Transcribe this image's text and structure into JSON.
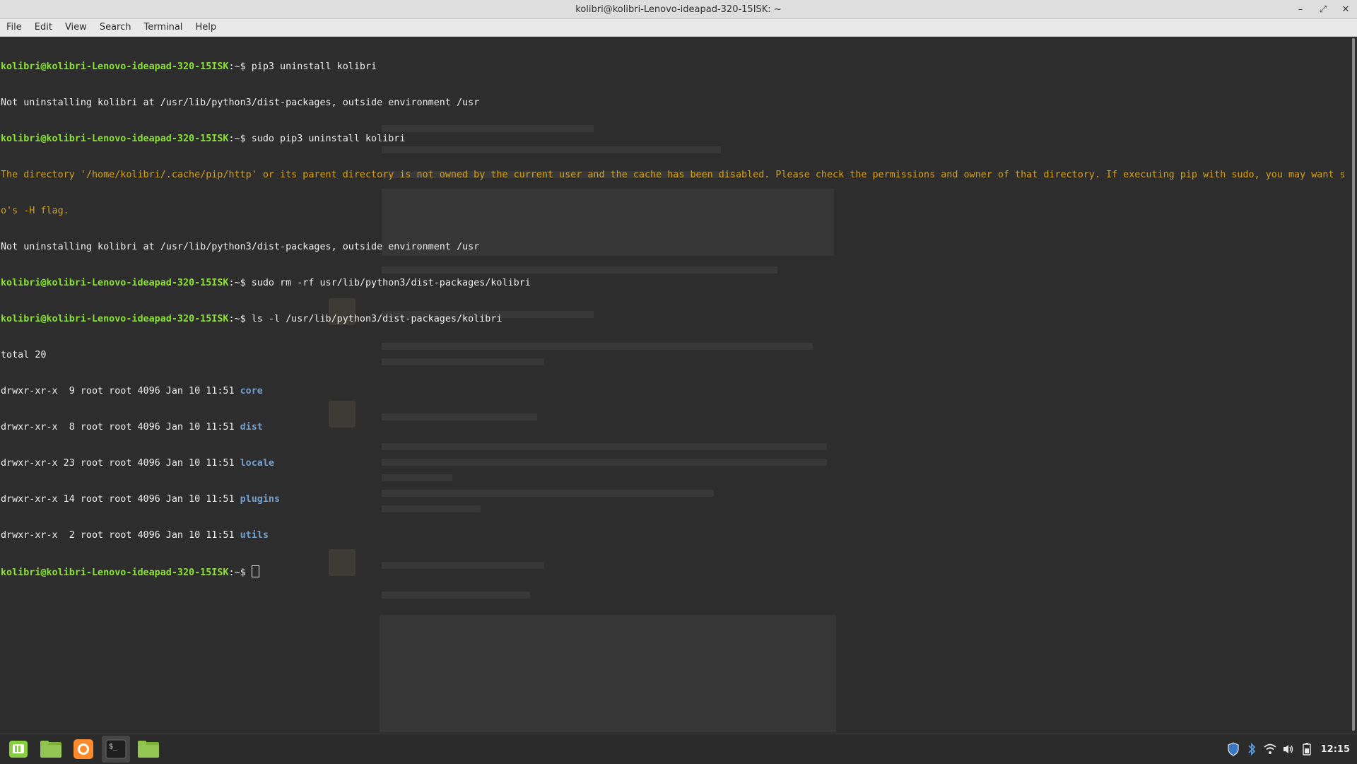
{
  "window": {
    "title": "kolibri@kolibri-Lenovo-ideapad-320-15ISK: ~",
    "controls": {
      "minimize": "–",
      "maximize": "⤢",
      "close": "✕"
    }
  },
  "menu": [
    "File",
    "Edit",
    "View",
    "Search",
    "Terminal",
    "Help"
  ],
  "terminal": {
    "prompt_user": "kolibri@kolibri-Lenovo-ideapad-320-15ISK",
    "prompt_suffix": ":~$ ",
    "lines": {
      "cmd1": "pip3 uninstall kolibri",
      "out1": "Not uninstalling kolibri at /usr/lib/python3/dist-packages, outside environment /usr",
      "cmd2": "sudo pip3 uninstall kolibri",
      "warn1": "The directory '/home/kolibri/.cache/pip/http' or its parent directory is not owned by the current user and the cache has been disabled. Please check the permissions and owner of that directory. If executing pip with sudo, you may want sud",
      "warn2": "o's -H flag.",
      "out2": "Not uninstalling kolibri at /usr/lib/python3/dist-packages, outside environment /usr",
      "cmd3": "sudo rm -rf usr/lib/python3/dist-packages/kolibri",
      "cmd4": "ls -l /usr/lib/python3/dist-packages/kolibri",
      "total": "total 20"
    },
    "listing": [
      {
        "meta": "drwxr-xr-x  9 root root 4096 Jan 10 11:51 ",
        "name": "core"
      },
      {
        "meta": "drwxr-xr-x  8 root root 4096 Jan 10 11:51 ",
        "name": "dist"
      },
      {
        "meta": "drwxr-xr-x 23 root root 4096 Jan 10 11:51 ",
        "name": "locale"
      },
      {
        "meta": "drwxr-xr-x 14 root root 4096 Jan 10 11:51 ",
        "name": "plugins"
      },
      {
        "meta": "drwxr-xr-x  2 root root 4096 Jan 10 11:51 ",
        "name": "utils"
      }
    ]
  },
  "taskbar": {
    "apps": [
      "mint-menu-icon",
      "files-icon",
      "firefox-icon",
      "terminal-icon",
      "folder-icon"
    ],
    "clock": "12:15"
  },
  "colors": {
    "prompt": "#8ae234",
    "warning": "#d6a21c",
    "directory": "#729fcf",
    "background": "#2d2d2d"
  }
}
